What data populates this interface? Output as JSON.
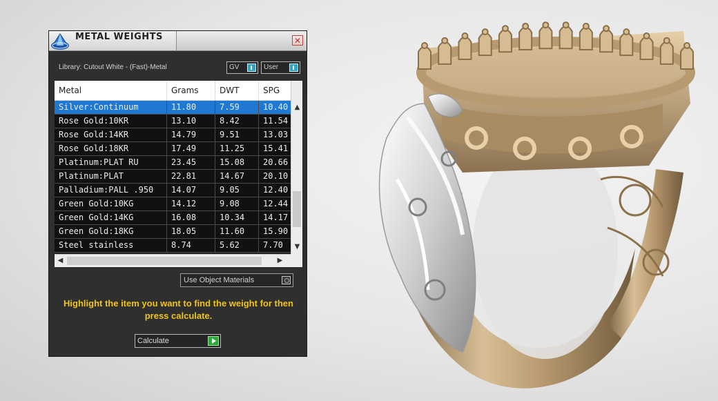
{
  "panel": {
    "title": "METAL WEIGHTS",
    "close_glyph": "✕",
    "library_label": "Library: Cutout White - (Fast)-Metal",
    "toggles": [
      {
        "label": "GV"
      },
      {
        "label": "User"
      }
    ],
    "table": {
      "columns": [
        "Metal",
        "Grams",
        "DWT",
        "SPG"
      ],
      "rows": [
        {
          "metal": "Silver:Continuum",
          "grams": "11.80",
          "dwt": "7.59",
          "spg": "10.40"
        },
        {
          "metal": "Rose Gold:10KR",
          "grams": "13.10",
          "dwt": "8.42",
          "spg": "11.54"
        },
        {
          "metal": "Rose Gold:14KR",
          "grams": "14.79",
          "dwt": "9.51",
          "spg": "13.03"
        },
        {
          "metal": "Rose Gold:18KR",
          "grams": "17.49",
          "dwt": "11.25",
          "spg": "15.41"
        },
        {
          "metal": "Platinum:PLAT RU",
          "grams": "23.45",
          "dwt": "15.08",
          "spg": "20.66"
        },
        {
          "metal": "Platinum:PLAT",
          "grams": "22.81",
          "dwt": "14.67",
          "spg": "20.10"
        },
        {
          "metal": "Palladium:PALL .950",
          "grams": "14.07",
          "dwt": "9.05",
          "spg": "12.40"
        },
        {
          "metal": "Green Gold:10KG",
          "grams": "14.12",
          "dwt": "9.08",
          "spg": "12.44"
        },
        {
          "metal": "Green Gold:14KG",
          "grams": "16.08",
          "dwt": "10.34",
          "spg": "14.17"
        },
        {
          "metal": "Green Gold:18KG",
          "grams": "18.05",
          "dwt": "11.60",
          "spg": "15.90"
        },
        {
          "metal": "Steel stainless",
          "grams": "8.74",
          "dwt": "5.62",
          "spg": "7.70"
        }
      ],
      "selected_index": 0
    },
    "use_object_materials": "Use Object Materials",
    "hint": "Highlight the item you want to find the weight for then press calculate.",
    "calculate_label": "Calculate"
  },
  "icons": {
    "app": "metal-weights-app-icon",
    "close": "close-icon",
    "toggle": "toggle-switch-icon",
    "radio": "radio-icon",
    "play": "play-arrow-icon"
  },
  "colors": {
    "selection": "#1f78d1",
    "hint_text": "#f0c419",
    "toggle_on": "#2ea4c8",
    "calc_arrow": "#2fa83a",
    "rose_gold": "#c9ad86",
    "white_metal": "#dcdcdc"
  }
}
